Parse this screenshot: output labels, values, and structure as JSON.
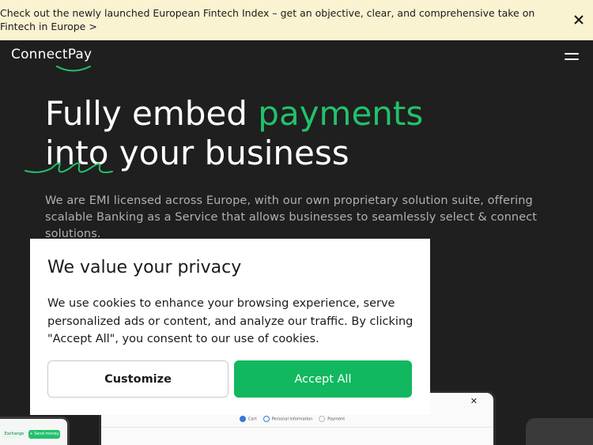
{
  "banner": {
    "text": "Check out the newly launched European Fintech Index – get an objective, clear, and comprehensive take on Fintech in Europe >",
    "close_icon": "close-icon"
  },
  "header": {
    "logo_text": "ConnectPay",
    "menu_icon": "hamburger-menu-icon"
  },
  "hero": {
    "title_part1": "Fully embed ",
    "title_accent": "payments",
    "title_line2": "into your business",
    "description": "We are EMI licensed across Europe, with our own proprietary solution suite, offering scalable Banking as a Service that allows businesses to seamlessly select & connect solutions."
  },
  "cookie_dialog": {
    "title": "We value your privacy",
    "text": "We use cookies to enhance your browsing experience, serve personalized ads or content, and analyze our traffic. By clicking \"Accept All\", you consent to our use of cookies.",
    "customize_label": "Customize",
    "accept_label": "Accept All"
  },
  "mockups": {
    "left_pill_a": "Exchange",
    "left_pill_b": "+ Send money",
    "center_close": "✕",
    "steps": [
      "Cart",
      "Personal information",
      "Payment"
    ]
  },
  "colors": {
    "banner_bg": "#faf3d2",
    "page_bg": "#1f1f1f",
    "accent_green": "#23c16b",
    "button_green": "#11b85f"
  }
}
